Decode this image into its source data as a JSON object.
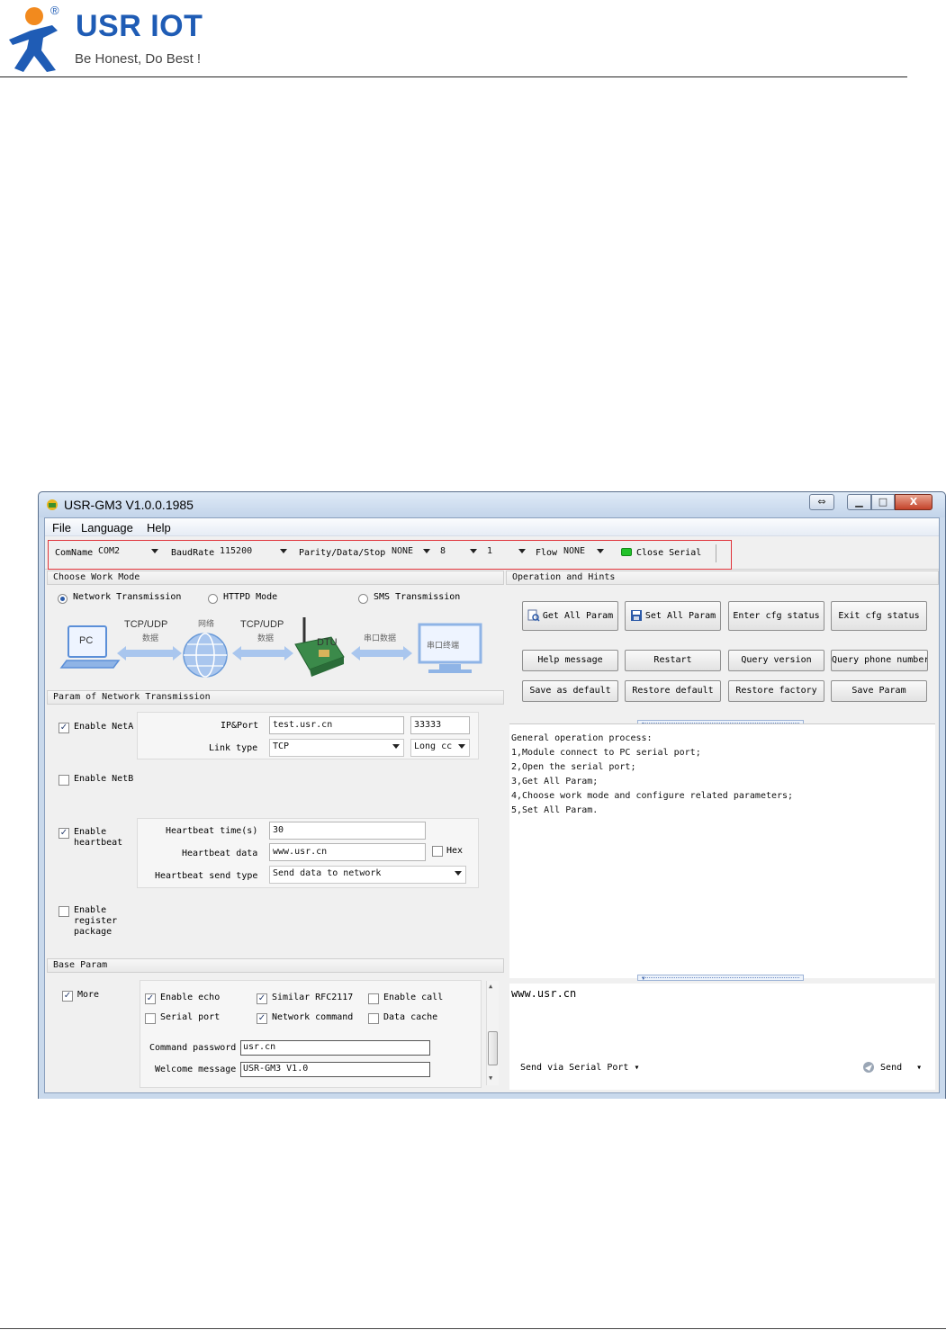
{
  "brand": {
    "name": "USR IOT",
    "registered_mark": "®",
    "slogan": "Be Honest, Do Best !",
    "colors": {
      "blue": "#1f5cb5",
      "orange": "#f28a1e"
    }
  },
  "window": {
    "title": "USR-GM3 V1.0.0.1985",
    "caption_buttons": {
      "swap": "⇔",
      "minimize": "▁",
      "maximize": "□",
      "close": "X"
    }
  },
  "menu": [
    "File",
    "Language",
    "Help"
  ],
  "serial": {
    "com_label": "ComName",
    "com_value": "COM2",
    "baud_label": "BaudRate",
    "baud_value": "115200",
    "parity_label": "Parity/Data/Stop",
    "parity_value": "NONE",
    "data_value": "8",
    "stop_value": "1",
    "flow_label": "Flow",
    "flow_value": "NONE",
    "close_label": "Close Serial",
    "status_color": "#22c22a"
  },
  "work_mode": {
    "title": "Choose Work Mode",
    "options": [
      "Network Transmission",
      "HTTPD Mode",
      "SMS Transmission"
    ],
    "selected": "Network Transmission",
    "diagram": {
      "pc": "PC",
      "tcp_left_top": "TCP/UDP",
      "tcp_left_bottom": "数据",
      "network": "网络",
      "tcp_right_top": "TCP/UDP",
      "tcp_right_bottom": "数据",
      "dtu": "DTU",
      "serial_data": "串口数据",
      "serial_terminal": "串口终端"
    }
  },
  "network_param": {
    "title": "Param of Network Transmission",
    "neta": {
      "label": "Enable NetA",
      "checked": true,
      "ip_port_label": "IP&Port",
      "host": "test.usr.cn",
      "port": "33333",
      "link_type_label": "Link type",
      "link_type": "TCP",
      "connection": "Long cc"
    },
    "netb": {
      "label": "Enable NetB",
      "checked": false
    },
    "heartbeat": {
      "label_line1": "Enable",
      "label_line2": "heartbeat",
      "checked": true,
      "time_label": "Heartbeat time(s)",
      "time_value": "30",
      "data_label": "Heartbeat data",
      "data_value": "www.usr.cn",
      "hex_label": "Hex",
      "send_type_label": "Heartbeat send type",
      "send_type_value": "Send data to network"
    },
    "register": {
      "label_line1": "Enable",
      "label_line2": "register",
      "label_line3": "package",
      "checked": false
    }
  },
  "base_param": {
    "title": "Base Param",
    "more": {
      "label": "More",
      "checked": true
    },
    "options": {
      "enable_echo": "Enable echo",
      "similar_rfc": "Similar RFC2117",
      "enable_call": "Enable call",
      "serial_port": "Serial port",
      "network_command": "Network command",
      "data_cache": "Data cache"
    },
    "command_password_label": "Command password",
    "command_password": "usr.cn",
    "welcome_label": "Welcome message",
    "welcome_value": "USR-GM3 V1.0"
  },
  "hints": {
    "title": "Operation and Hints",
    "buttons_row1": [
      "Get All Param",
      "Set All Param",
      "Enter cfg status",
      "Exit cfg status"
    ],
    "buttons_row2": [
      "Help message",
      "Restart",
      "Query version",
      "Query phone number"
    ],
    "buttons_row3": [
      "Save as default",
      "Restore default",
      "Restore factory",
      "Save Param"
    ],
    "text": "General operation process:\n1,Module connect to PC serial port;\n2,Open the serial port;\n3,Get All Param;\n4,Choose work mode and configure related parameters;\n5,Set All Param."
  },
  "send": {
    "input_text": "www.usr.cn",
    "via_label": "Send via Serial Port",
    "send_label": "Send"
  }
}
